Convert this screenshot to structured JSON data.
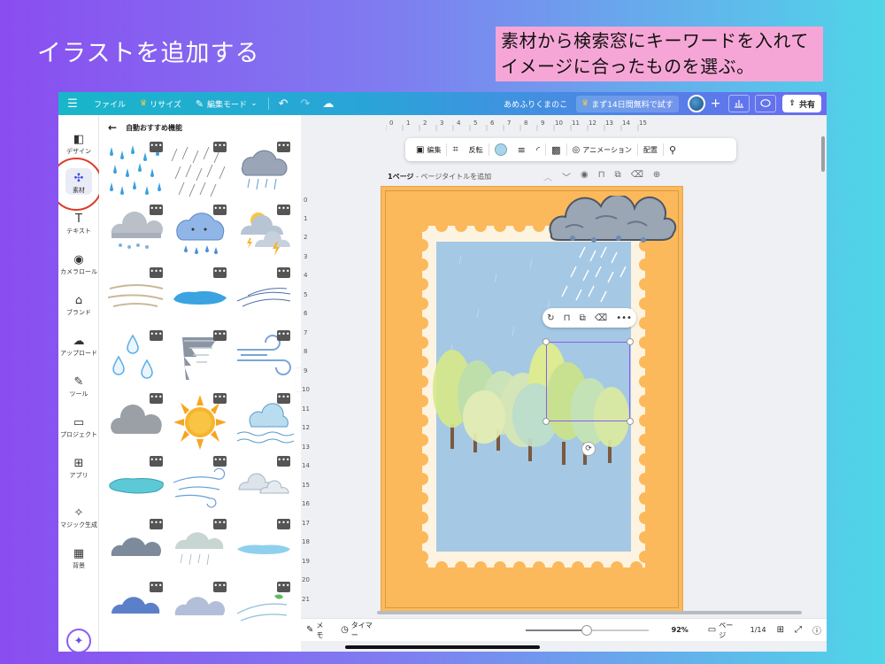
{
  "slide": {
    "heading": "イラストを追加する",
    "callout": "素材から検索窓にキーワードを入れてイメージに合ったものを選ぶ。"
  },
  "topbar": {
    "menu_icon": "menu-icon",
    "file": "ファイル",
    "resize": "リサイズ",
    "edit_mode": "編集モード",
    "doc_name": "あめふりくまのこ",
    "trial": "まず14日間無料で試す",
    "share": "共有"
  },
  "rail": {
    "items": [
      {
        "label": "デザイン",
        "icon": "design-icon"
      },
      {
        "label": "素材",
        "icon": "elements-icon"
      },
      {
        "label": "テキスト",
        "icon": "text-icon"
      },
      {
        "label": "カメラロール",
        "icon": "camera-icon"
      },
      {
        "label": "ブランド",
        "icon": "brand-icon"
      },
      {
        "label": "アップロード",
        "icon": "upload-icon"
      },
      {
        "label": "ツール",
        "icon": "tools-icon"
      },
      {
        "label": "プロジェクト",
        "icon": "folder-icon"
      },
      {
        "label": "アプリ",
        "icon": "apps-icon"
      },
      {
        "label": "マジック生成",
        "icon": "magic-icon"
      },
      {
        "label": "背景",
        "icon": "background-icon"
      }
    ]
  },
  "panel": {
    "title": "自動おすすめ機能",
    "more_label": "•••"
  },
  "ruler": {
    "top": [
      "0",
      "1",
      "2",
      "3",
      "4",
      "5",
      "6",
      "7",
      "8",
      "9",
      "10",
      "11",
      "12",
      "13",
      "14",
      "15"
    ],
    "left": [
      "0",
      "1",
      "2",
      "3",
      "4",
      "5",
      "6",
      "7",
      "8",
      "9",
      "10",
      "11",
      "12",
      "13",
      "14",
      "15",
      "16",
      "17",
      "18",
      "19",
      "20",
      "21"
    ]
  },
  "float_toolbar": {
    "edit": "編集",
    "flip": "反転",
    "animation": "アニメーション",
    "position": "配置",
    "swatch_color": "#a9d4ef"
  },
  "page_header": {
    "page": "1ページ",
    "title_placeholder": "ページタイトルを追加"
  },
  "bottombar": {
    "notes": "メモ",
    "timer": "タイマー",
    "zoom": "92%",
    "zoom_fraction": 0.5,
    "pages": "ページ",
    "page_count": "1/14"
  }
}
